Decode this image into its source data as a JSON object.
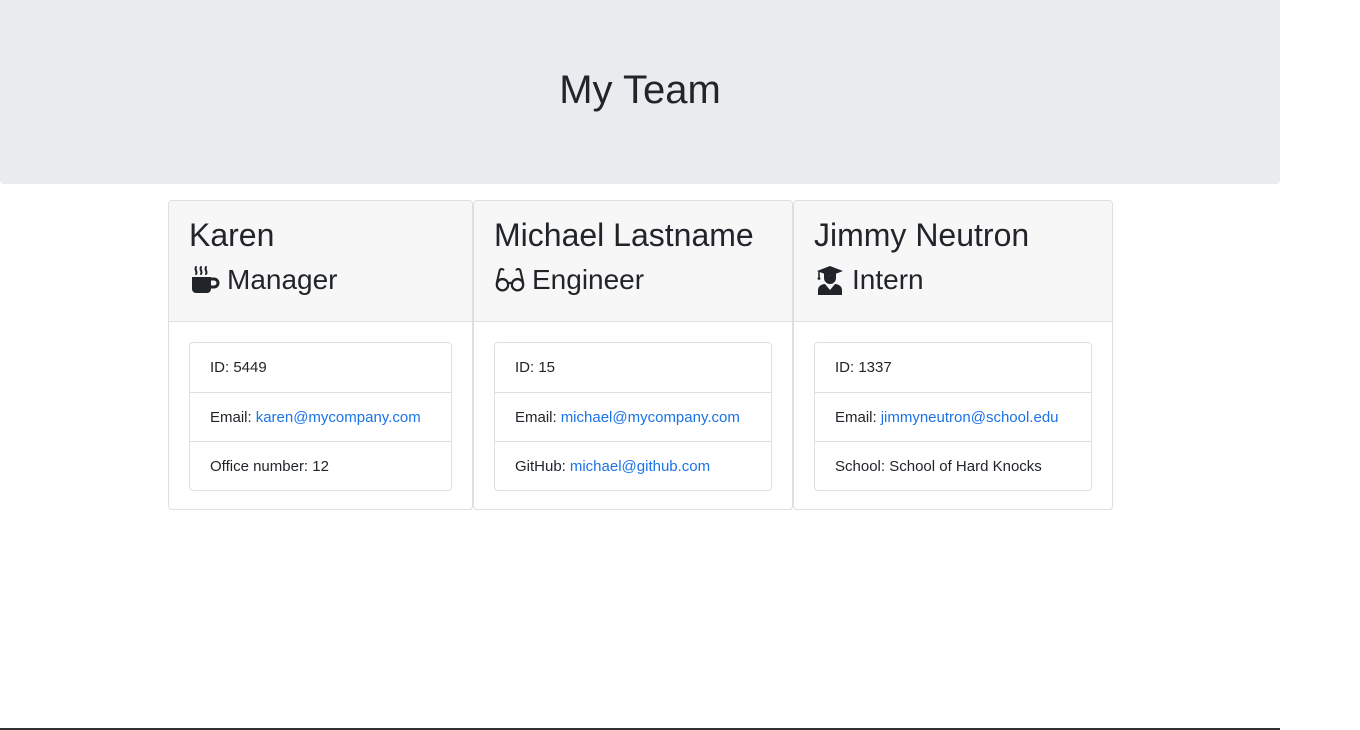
{
  "header": {
    "title": "My Team"
  },
  "employees": [
    {
      "name": "Karen",
      "role": "Manager",
      "icon": "coffee-icon",
      "id_label": "ID:",
      "id": "5449",
      "email_label": "Email:",
      "email": "karen@mycompany.com",
      "extra_label": "Office number:",
      "extra": "12"
    },
    {
      "name": "Michael Lastname",
      "role": "Engineer",
      "icon": "glasses-icon",
      "id_label": "ID:",
      "id": "15",
      "email_label": "Email:",
      "email": "michael@mycompany.com",
      "extra_label": "GitHub:",
      "extra": "michael@github.com"
    },
    {
      "name": "Jimmy Neutron",
      "role": "Intern",
      "icon": "graduate-icon",
      "id_label": "ID:",
      "id": "1337",
      "email_label": "Email:",
      "email": "jimmyneutron@school.edu",
      "extra_label": "School:",
      "extra": "School of Hard Knocks"
    }
  ],
  "colors": {
    "link": "#1a73e8",
    "jumbotron": "#e9ecef",
    "card_header": "#f7f7f7"
  }
}
